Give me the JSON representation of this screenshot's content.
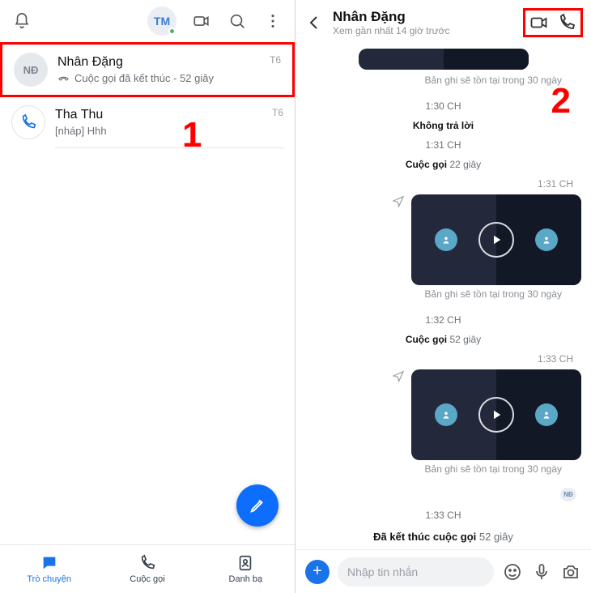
{
  "left": {
    "avatar_initials": "TM",
    "chats": [
      {
        "avatar": "NĐ",
        "title": "Nhân Đặng",
        "sub": "Cuộc gọi đã kết thúc - 52 giây",
        "time": "T6"
      },
      {
        "avatar": "phone",
        "title": "Tha Thu",
        "sub": "[nháp] Hhh",
        "time": "T6"
      }
    ],
    "nav": {
      "chat": "Trò chuyện",
      "call": "Cuộc gọi",
      "contacts": "Danh bạ"
    },
    "annotation": "1"
  },
  "right": {
    "name": "Nhân Đặng",
    "lastseen": "Xem gần nhất 14 giờ trước",
    "annotation": "2",
    "items": {
      "caption": "Bản ghi sẽ tồn tại trong 30 ngày",
      "t1": "1:30 CH",
      "l1": "Không trả lời",
      "t2": "1:31 CH",
      "l2a": "Cuộc gọi",
      "l2b": "22 giây",
      "t3": "1:31 CH",
      "t4": "1:32 CH",
      "l4a": "Cuộc gọi",
      "l4b": "52 giây",
      "t5": "1:33 CH",
      "t6": "1:33 CH",
      "l6a": "Đã kết thúc cuộc gọi",
      "l6b": "52 giây",
      "seen": "NĐ"
    },
    "placeholder": "Nhập tin nhắn"
  }
}
